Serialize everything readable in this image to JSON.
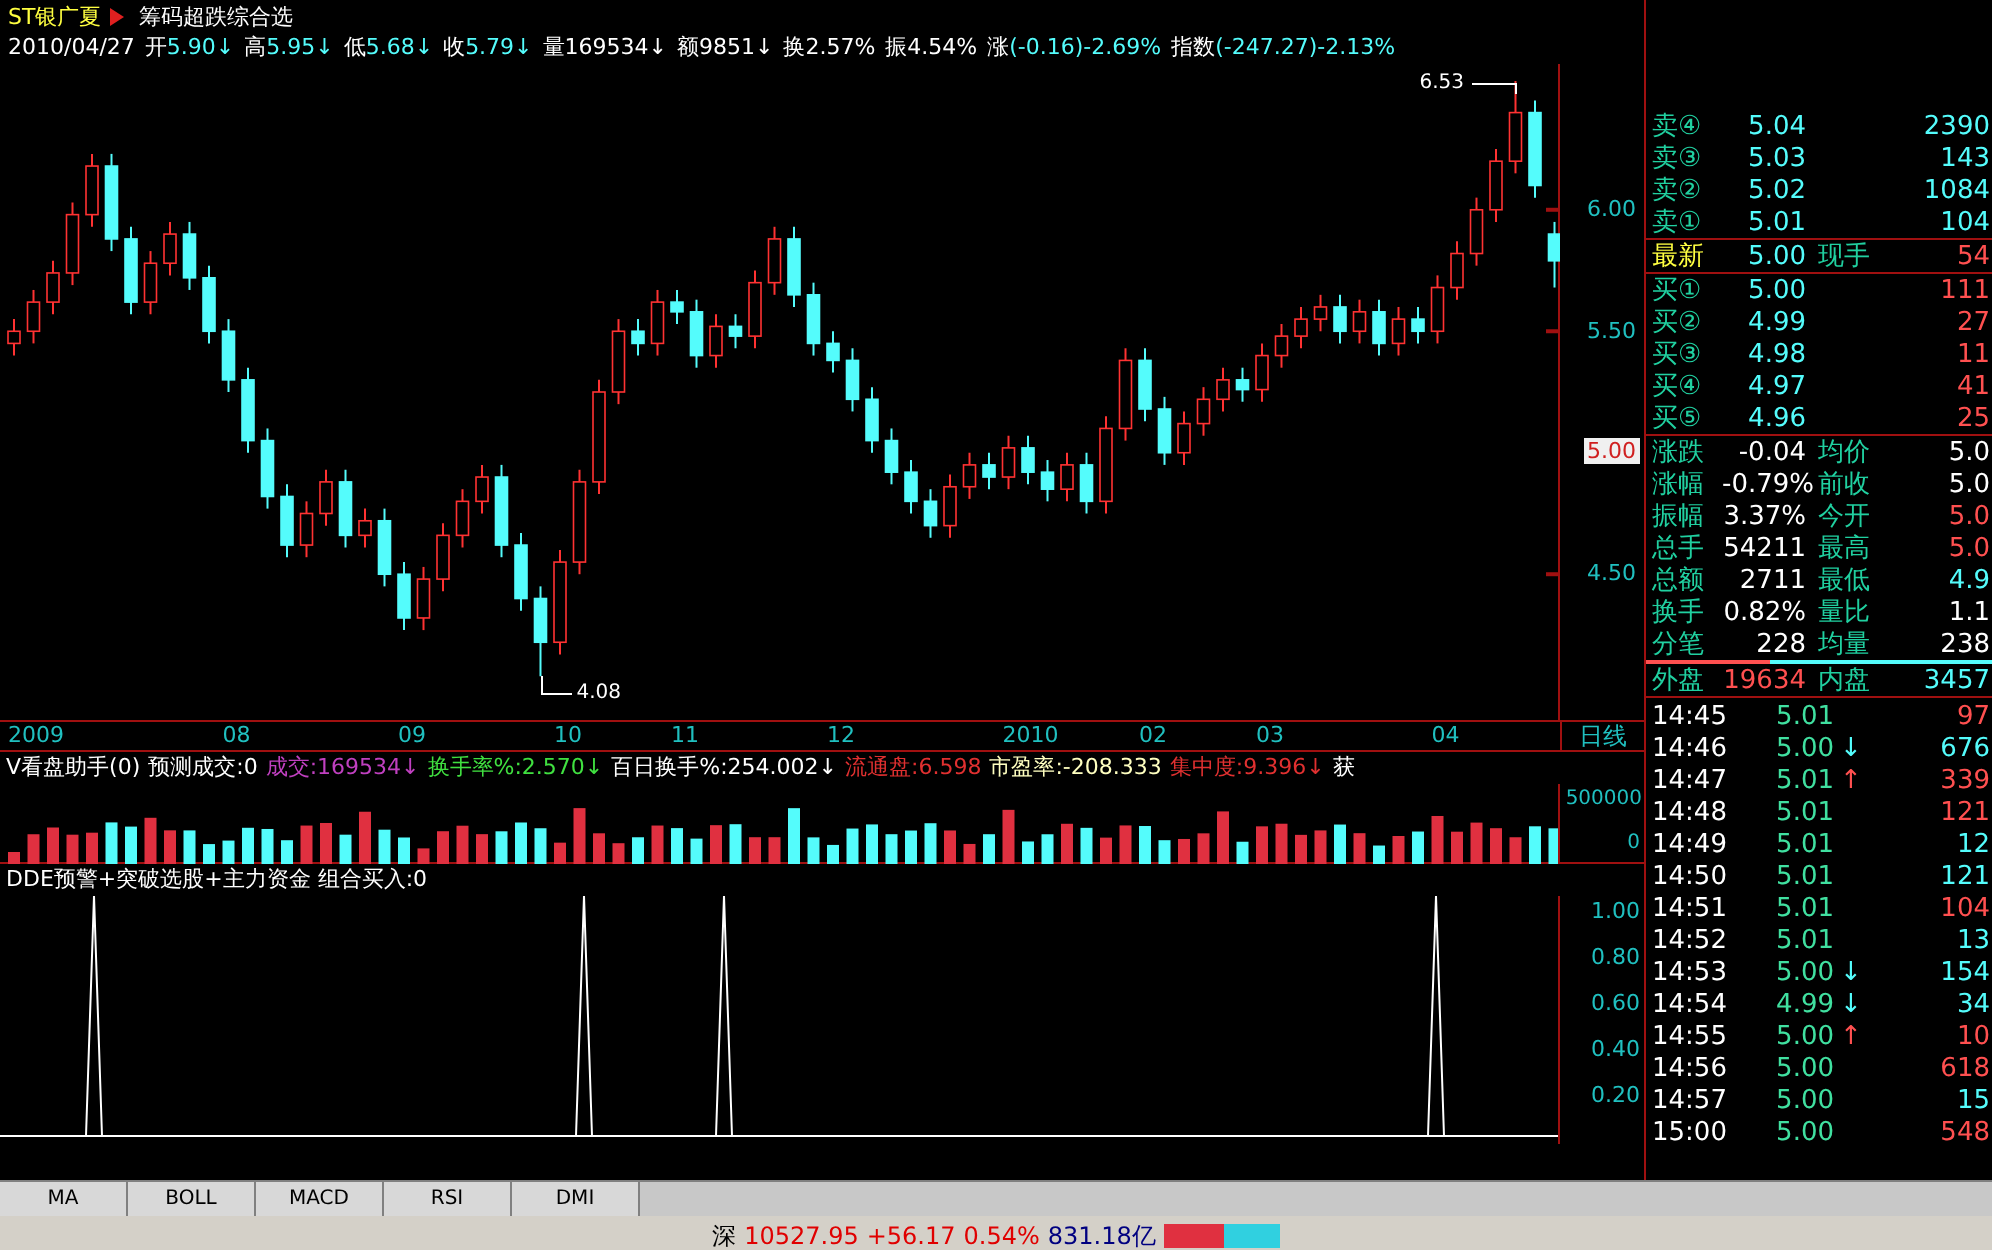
{
  "title": {
    "stock": "ST银广夏",
    "formula": "筹码超跌综合选"
  },
  "quote_line": [
    {
      "value": "2010/04/27",
      "color": "#ffffff"
    },
    {
      "label": "开",
      "value": "5.90↓",
      "color": "#54fcfc"
    },
    {
      "label": "高",
      "value": "5.95↓",
      "color": "#54fcfc"
    },
    {
      "label": "低",
      "value": "5.68↓",
      "color": "#54fcfc"
    },
    {
      "label": "收",
      "value": "5.79↓",
      "color": "#54fcfc"
    },
    {
      "label": "量",
      "value": "169534↓",
      "color": "#ffffff"
    },
    {
      "label": "额",
      "value": "9851↓",
      "color": "#ffffff"
    },
    {
      "label": "换",
      "value": "2.57%",
      "color": "#ffffff"
    },
    {
      "label": "振",
      "value": "4.54%",
      "color": "#ffffff"
    },
    {
      "label": "涨",
      "value": "(-0.16)-2.69%",
      "color": "#54fcfc"
    },
    {
      "label": "指数",
      "value": "(-247.27)-2.13%",
      "color": "#54fcfc"
    }
  ],
  "main_chart": {
    "high_label": "6.53",
    "low_label": "4.08",
    "current_price_tag": "5.00",
    "chart_data": {
      "type": "candlestick",
      "ylim": [
        3.9,
        6.6
      ],
      "yticks": [
        {
          "value": 6.0,
          "label": "6.00"
        },
        {
          "value": 5.5,
          "label": "5.50"
        },
        {
          "value": 4.5,
          "label": "4.50"
        }
      ],
      "ohlc": [
        [
          5.45,
          5.55,
          5.4,
          5.5
        ],
        [
          5.5,
          5.67,
          5.45,
          5.62
        ],
        [
          5.62,
          5.79,
          5.57,
          5.74
        ],
        [
          5.74,
          6.03,
          5.69,
          5.98
        ],
        [
          5.98,
          6.23,
          5.93,
          6.18
        ],
        [
          6.18,
          6.23,
          5.83,
          5.88
        ],
        [
          5.88,
          5.93,
          5.57,
          5.62
        ],
        [
          5.62,
          5.83,
          5.57,
          5.78
        ],
        [
          5.78,
          5.95,
          5.73,
          5.9
        ],
        [
          5.9,
          5.95,
          5.67,
          5.72
        ],
        [
          5.72,
          5.77,
          5.45,
          5.5
        ],
        [
          5.5,
          5.55,
          5.25,
          5.3
        ],
        [
          5.3,
          5.35,
          5.0,
          5.05
        ],
        [
          5.05,
          5.1,
          4.77,
          4.82
        ],
        [
          4.82,
          4.87,
          4.57,
          4.62
        ],
        [
          4.62,
          4.8,
          4.57,
          4.75
        ],
        [
          4.75,
          4.93,
          4.7,
          4.88
        ],
        [
          4.88,
          4.93,
          4.61,
          4.66
        ],
        [
          4.66,
          4.77,
          4.61,
          4.72
        ],
        [
          4.72,
          4.77,
          4.45,
          4.5
        ],
        [
          4.5,
          4.55,
          4.27,
          4.32
        ],
        [
          4.32,
          4.53,
          4.27,
          4.48
        ],
        [
          4.48,
          4.71,
          4.43,
          4.66
        ],
        [
          4.66,
          4.85,
          4.61,
          4.8
        ],
        [
          4.8,
          4.95,
          4.75,
          4.9
        ],
        [
          4.9,
          4.95,
          4.57,
          4.62
        ],
        [
          4.62,
          4.67,
          4.35,
          4.4
        ],
        [
          4.4,
          4.45,
          4.08,
          4.22
        ],
        [
          4.22,
          4.6,
          4.17,
          4.55
        ],
        [
          4.55,
          4.93,
          4.5,
          4.88
        ],
        [
          4.88,
          5.3,
          4.83,
          5.25
        ],
        [
          5.25,
          5.55,
          5.2,
          5.5
        ],
        [
          5.5,
          5.55,
          5.4,
          5.45
        ],
        [
          5.45,
          5.67,
          5.4,
          5.62
        ],
        [
          5.62,
          5.67,
          5.53,
          5.58
        ],
        [
          5.58,
          5.63,
          5.35,
          5.4
        ],
        [
          5.4,
          5.57,
          5.35,
          5.52
        ],
        [
          5.52,
          5.57,
          5.43,
          5.48
        ],
        [
          5.48,
          5.75,
          5.43,
          5.7
        ],
        [
          5.7,
          5.93,
          5.65,
          5.88
        ],
        [
          5.88,
          5.93,
          5.6,
          5.65
        ],
        [
          5.65,
          5.7,
          5.4,
          5.45
        ],
        [
          5.45,
          5.5,
          5.33,
          5.38
        ],
        [
          5.38,
          5.43,
          5.17,
          5.22
        ],
        [
          5.22,
          5.27,
          5.0,
          5.05
        ],
        [
          5.05,
          5.1,
          4.87,
          4.92
        ],
        [
          4.92,
          4.97,
          4.75,
          4.8
        ],
        [
          4.8,
          4.85,
          4.65,
          4.7
        ],
        [
          4.7,
          4.91,
          4.65,
          4.86
        ],
        [
          4.86,
          5.0,
          4.81,
          4.95
        ],
        [
          4.95,
          5.0,
          4.85,
          4.9
        ],
        [
          4.9,
          5.07,
          4.85,
          5.02
        ],
        [
          5.02,
          5.07,
          4.87,
          4.92
        ],
        [
          4.92,
          4.97,
          4.8,
          4.85
        ],
        [
          4.85,
          5.0,
          4.8,
          4.95
        ],
        [
          4.95,
          5.0,
          4.75,
          4.8
        ],
        [
          4.8,
          5.15,
          4.75,
          5.1
        ],
        [
          5.1,
          5.43,
          5.05,
          5.38
        ],
        [
          5.38,
          5.43,
          5.13,
          5.18
        ],
        [
          5.18,
          5.23,
          4.95,
          5.0
        ],
        [
          5.0,
          5.17,
          4.95,
          5.12
        ],
        [
          5.12,
          5.27,
          5.07,
          5.22
        ],
        [
          5.22,
          5.35,
          5.17,
          5.3
        ],
        [
          5.3,
          5.35,
          5.21,
          5.26
        ],
        [
          5.26,
          5.45,
          5.21,
          5.4
        ],
        [
          5.4,
          5.53,
          5.35,
          5.48
        ],
        [
          5.48,
          5.6,
          5.43,
          5.55
        ],
        [
          5.55,
          5.65,
          5.5,
          5.6
        ],
        [
          5.6,
          5.65,
          5.45,
          5.5
        ],
        [
          5.5,
          5.63,
          5.45,
          5.58
        ],
        [
          5.58,
          5.63,
          5.4,
          5.45
        ],
        [
          5.45,
          5.6,
          5.4,
          5.55
        ],
        [
          5.55,
          5.6,
          5.45,
          5.5
        ],
        [
          5.5,
          5.73,
          5.45,
          5.68
        ],
        [
          5.68,
          5.87,
          5.63,
          5.82
        ],
        [
          5.82,
          6.05,
          5.77,
          6.0
        ],
        [
          6.0,
          6.25,
          5.95,
          6.2
        ],
        [
          6.2,
          6.53,
          6.15,
          6.4
        ],
        [
          6.4,
          6.45,
          6.05,
          6.1
        ],
        [
          5.9,
          5.95,
          5.68,
          5.79
        ]
      ]
    }
  },
  "date_axis": [
    "2009",
    "08",
    "09",
    "10",
    "11",
    "12",
    "2010",
    "02",
    "03",
    "04"
  ],
  "period": "日线",
  "indicator_line": [
    {
      "text": "V看盘助手(0)",
      "color": "#ffffff"
    },
    {
      "text": "预测成交:0",
      "color": "#ffffff"
    },
    {
      "text": "成交:169534↓",
      "color": "#c040c0"
    },
    {
      "text": "换手率%:2.570↓",
      "color": "#40e040"
    },
    {
      "text": "百日换手%:254.002↓",
      "color": "#ffffff"
    },
    {
      "text": "流通盘:6.598",
      "color": "#e03030"
    },
    {
      "text": "市盈率:-208.333",
      "color": "#ffffc0"
    },
    {
      "text": "集中度:9.396↓",
      "color": "#e03030"
    },
    {
      "text": "获",
      "color": "#ffffff"
    }
  ],
  "volume_axis": [
    "500000",
    "0"
  ],
  "dde": {
    "title": "DDE预警+突破选股+主力资金 组合买入:0",
    "axis": [
      "1.00",
      "0.80",
      "0.60",
      "0.40",
      "0.20"
    ]
  },
  "order_book": [
    {
      "label": "卖④",
      "price": "5.04",
      "volume": "2390",
      "color": "#54fcfc"
    },
    {
      "label": "卖③",
      "price": "5.03",
      "volume": "143",
      "color": "#54fcfc"
    },
    {
      "label": "卖②",
      "price": "5.02",
      "volume": "1084",
      "color": "#54fcfc"
    },
    {
      "label": "卖①",
      "price": "5.01",
      "volume": "104",
      "color": "#54fcfc"
    }
  ],
  "last": {
    "label": "最新",
    "price": "5.00",
    "label2": "现手",
    "value2": "54"
  },
  "bids": [
    {
      "label": "买①",
      "price": "5.00",
      "volume": "111",
      "color": "#ff5050"
    },
    {
      "label": "买②",
      "price": "4.99",
      "volume": "27",
      "color": "#ff5050"
    },
    {
      "label": "买③",
      "price": "4.98",
      "volume": "11",
      "color": "#ff5050"
    },
    {
      "label": "买④",
      "price": "4.97",
      "volume": "41",
      "color": "#ff5050"
    },
    {
      "label": "买⑤",
      "price": "4.96",
      "volume": "25",
      "color": "#ff5050"
    }
  ],
  "stats": [
    {
      "label": "涨跌",
      "value": "-0.04",
      "label2": "均价",
      "value2": "5.0",
      "color": "#ffffff"
    },
    {
      "label": "涨幅",
      "value": "-0.79%",
      "label2": "前收",
      "value2": "5.0",
      "color": "#ffffff"
    },
    {
      "label": "振幅",
      "value": "3.37%",
      "label2": "今开",
      "value2": "5.0",
      "color": "#ff5050"
    },
    {
      "label": "总手",
      "value": "54211",
      "label2": "最高",
      "value2": "5.0",
      "color": "#ff5050"
    },
    {
      "label": "总额",
      "value": "2711",
      "label2": "最低",
      "value2": "4.9",
      "color": "#54fcfc"
    },
    {
      "label": "换手",
      "value": "0.82%",
      "label2": "量比",
      "value2": "1.1",
      "color": "#ffffff"
    },
    {
      "label": "分笔",
      "value": "228",
      "label2": "均量",
      "value2": "238",
      "color": "#ffffff"
    }
  ],
  "outer_inner": {
    "label": "外盘",
    "value": "19634",
    "label2": "内盘",
    "value2": "3457",
    "level": 0.36
  },
  "trades": [
    {
      "time": "14:45",
      "price": "5.01",
      "volume": "97",
      "color": "#ff5050"
    },
    {
      "time": "14:46",
      "price": "5.00",
      "arrow": {
        "text": "↓",
        "color": "#54fcfc"
      },
      "volume": "676",
      "color": "#54fcfc"
    },
    {
      "time": "14:47",
      "price": "5.01",
      "arrow": {
        "text": "↑",
        "color": "#ff5050"
      },
      "volume": "339",
      "color": "#ff5050"
    },
    {
      "time": "14:48",
      "price": "5.01",
      "volume": "121",
      "color": "#ff5050"
    },
    {
      "time": "14:49",
      "price": "5.01",
      "volume": "12",
      "color": "#54fcfc"
    },
    {
      "time": "14:50",
      "price": "5.01",
      "volume": "121",
      "color": "#54fcfc"
    },
    {
      "time": "14:51",
      "price": "5.01",
      "volume": "104",
      "color": "#ff5050"
    },
    {
      "time": "14:52",
      "price": "5.01",
      "volume": "13",
      "color": "#54fcfc"
    },
    {
      "time": "14:53",
      "price": "5.00",
      "arrow": {
        "text": "↓",
        "color": "#54fcfc"
      },
      "volume": "154",
      "color": "#54fcfc"
    },
    {
      "time": "14:54",
      "price": "4.99",
      "arrow": {
        "text": "↓",
        "color": "#54fcfc"
      },
      "volume": "34",
      "color": "#54fcfc"
    },
    {
      "time": "14:55",
      "price": "5.00",
      "arrow": {
        "text": "↑",
        "color": "#ff5050"
      },
      "volume": "10",
      "color": "#ff5050"
    },
    {
      "time": "14:56",
      "price": "5.00",
      "volume": "618",
      "color": "#ff5050"
    },
    {
      "time": "14:57",
      "price": "5.00",
      "volume": "15",
      "color": "#54fcfc"
    },
    {
      "time": "15:00",
      "price": "5.00",
      "volume": "548",
      "color": "#ff5050"
    }
  ],
  "tabs": [
    "MA",
    "BOLL",
    "MACD",
    "RSI",
    "DMI"
  ],
  "status": {
    "market": "深",
    "index": "10527.95",
    "change": "+56.17",
    "percent": "0.54%",
    "turnover": "831.18亿"
  }
}
